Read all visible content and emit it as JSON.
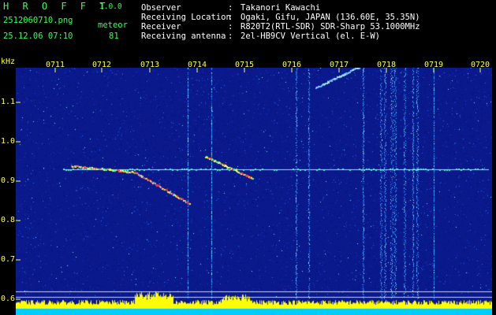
{
  "header": {
    "logo": "H R O F F T",
    "version": "1.0.0",
    "filename": "2512060710.png",
    "datetime": "25.12.06 07:10",
    "meteor_label": "meteor",
    "meteor_count": "81",
    "info": [
      {
        "label": "Observer",
        "value": "Takanori Kawachi"
      },
      {
        "label": "Receiving Location",
        "value": "Ogaki, Gifu, JAPAN (136.60E, 35.35N)"
      },
      {
        "label": "Receiver",
        "value": "R820T2(RTL-SDR) SDR-Sharp 53.1000MHz"
      },
      {
        "label": "Receiving antenna",
        "value": "2el-HB9CV Vertical (el. E-W)"
      }
    ],
    "separator": ":"
  },
  "axis": {
    "unit": "kHz",
    "y_ticks": [
      "1.1",
      "1.0",
      "0.9",
      "0.8",
      "0.7",
      "0.6"
    ],
    "x_ticks": [
      "0711",
      "0712",
      "0713",
      "0714",
      "0715",
      "0716",
      "0717",
      "0718",
      "0719",
      "0720"
    ]
  },
  "colors": {
    "background": "#000000",
    "spectrum_base": "#0a1a8c",
    "header_green": "#33ff55",
    "label_yellow": "#ffff44",
    "level_bar": "#ffff00",
    "level_base": "#00ccff"
  }
}
